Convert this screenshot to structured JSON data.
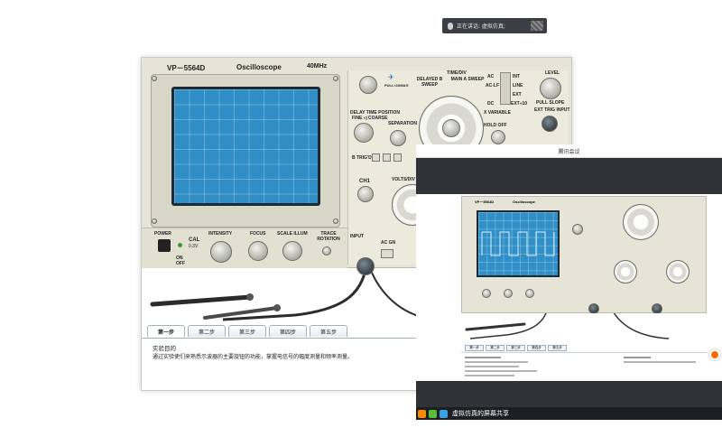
{
  "speaking_banner": {
    "text": "正在讲话: 虚拟仿真;"
  },
  "oscilloscope": {
    "model": "VP－5564D",
    "title": "Oscilloscope",
    "bandwidth": "40MHz",
    "labels": {
      "pull_x10mag": "PULL×10MAG",
      "time_div": "TIME/DIV",
      "delayed_b_sweep": "DELAYED B SWEEP",
      "main_a_sweep": "MAIN A SWEEP",
      "ac": "AC",
      "ac_lf": "AC-LF",
      "dc": "DC",
      "int": "INT",
      "line": "LINE",
      "ext": "EXT",
      "ext_10": "EXT÷10",
      "level": "LEVEL",
      "pull_slope": "PULL SLOPE",
      "ext_trig_input": "EXT TRIG INPUT",
      "delay_time_position": "DELAY TIME POSITION",
      "fine_coarse": "FINE ◁ COARSE",
      "separation": "SEPARATION",
      "x_variable": "X VARIABLE",
      "hold_off": "HOLD OFF",
      "ch1": "CH1",
      "volts_div": "VOLTS/DIV",
      "b_trig_d": "B TRIG'D",
      "power": "POWER",
      "on": "ON",
      "off": "OFF",
      "cal": "CAL",
      "cal_value": "0.3V",
      "intensity": "INTENSITY",
      "focus": "FOCUS",
      "scale_illum": "SCALE ILLUM",
      "trace_rotation": "TRACE ROTATION",
      "input": "INPUT",
      "ac_gnd": "AC GN"
    }
  },
  "tabs": [
    "第一步",
    "第二步",
    "第三步",
    "第四步",
    "第五步"
  ],
  "active_tab": 0,
  "instructions": {
    "title": "实验目的",
    "text": "通过实验使们来熟悉示波器的主要旋钮的功能，掌握电信号的幅度测量和频率测量。"
  },
  "share_window": {
    "title": "腾讯会议",
    "footer_text": "虚拟仿真的屏幕共享",
    "mini_model": "VP－5564D",
    "mini_title": "Oscilloscope",
    "mini_tabs": [
      "第一步",
      "第二步",
      "第三步",
      "第四步",
      "第五步"
    ]
  },
  "colors": {
    "panel": "#e6e4d6",
    "crt": "#2f8fc6",
    "share_bg": "#2f3338",
    "badge": "#ff6a00"
  }
}
